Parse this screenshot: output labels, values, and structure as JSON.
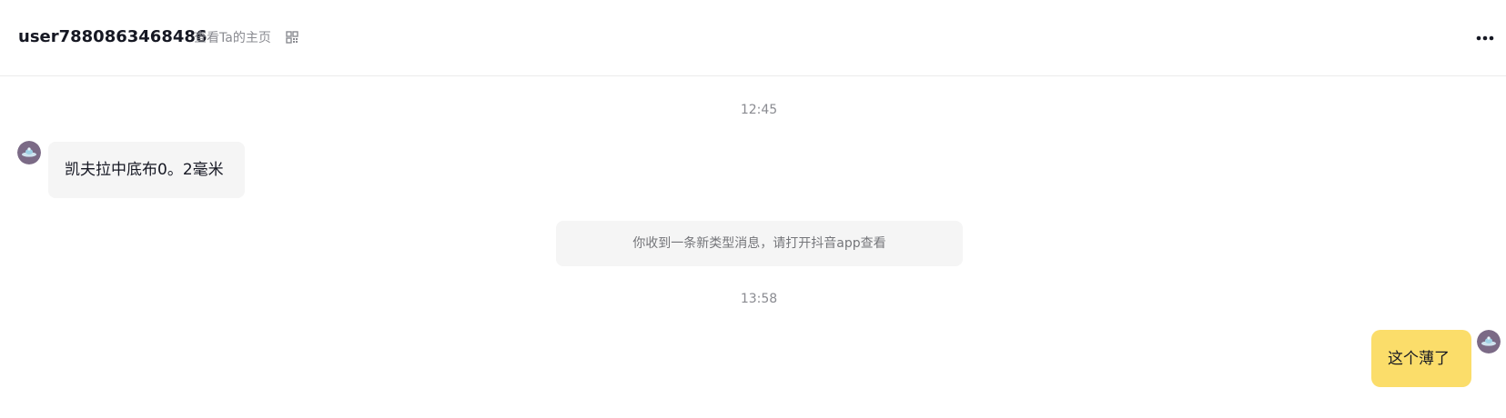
{
  "header": {
    "username": "user7880863468486",
    "profile_link": "查看Ta的主页"
  },
  "icons": {
    "qr": "qrcode-icon",
    "more": "more-horizontal-icon",
    "avatar": "user-avatar"
  },
  "messages": [
    {
      "type": "timestamp",
      "text": "12:45"
    },
    {
      "type": "incoming",
      "text": "凯夫拉中底布0。2毫米"
    },
    {
      "type": "system",
      "text": "你收到一条新类型消息，请打开抖音app查看"
    },
    {
      "type": "timestamp",
      "text": "13:58"
    },
    {
      "type": "outgoing",
      "text": "这个薄了"
    }
  ],
  "colors": {
    "outgoing_bubble": "#fbdd6a",
    "incoming_bubble": "#f5f5f5",
    "system_bubble": "#f5f5f5",
    "muted_text": "#8a8b91"
  }
}
